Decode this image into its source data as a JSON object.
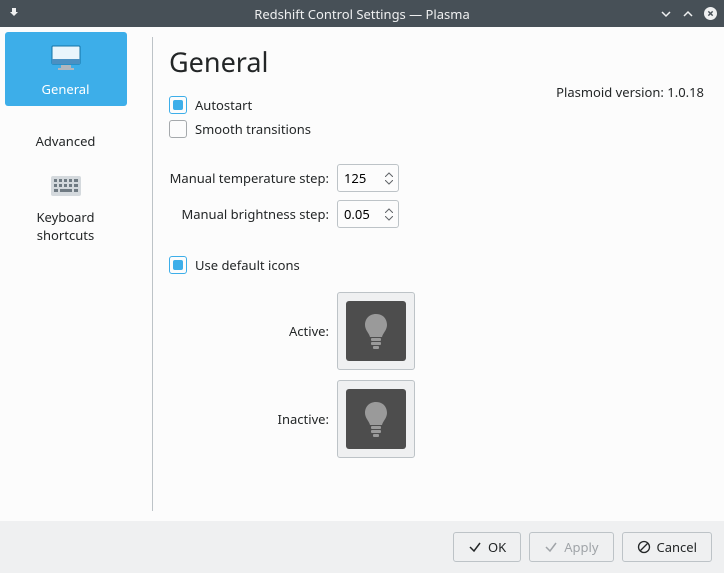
{
  "window": {
    "title": "Redshift Control Settings — Plasma"
  },
  "sidebar": {
    "items": [
      {
        "label": "General",
        "icon": "monitor-icon"
      },
      {
        "label": "Advanced",
        "icon": ""
      },
      {
        "label": "Keyboard shortcuts",
        "icon": "keyboard-icon"
      }
    ]
  },
  "page": {
    "heading": "General",
    "autostart_label": "Autostart",
    "autostart_checked": true,
    "smooth_label": "Smooth transitions",
    "smooth_checked": false,
    "version_label": "Plasmoid version: 1.0.18",
    "temp_step_label": "Manual temperature step:",
    "temp_step_value": "125",
    "brightness_step_label": "Manual brightness step:",
    "brightness_step_value": "0.05",
    "use_default_icons_label": "Use default icons",
    "use_default_icons_checked": true,
    "active_icon_label": "Active:",
    "inactive_icon_label": "Inactive:"
  },
  "buttons": {
    "ok": "OK",
    "apply": "Apply",
    "cancel": "Cancel"
  }
}
